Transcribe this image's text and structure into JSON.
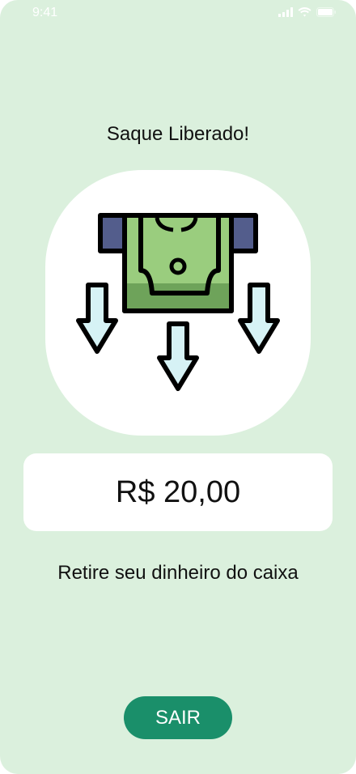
{
  "status_bar": {
    "time": "9:41"
  },
  "title": "Saque Liberado!",
  "illustration": {
    "icon": "cash-withdrawal-icon"
  },
  "amount": "R$ 20,00",
  "instruction": "Retire seu dinheiro do caixa",
  "exit_button": {
    "label": "SAIR"
  },
  "colors": {
    "background": "#dbf0dd",
    "card": "#ffffff",
    "button": "#1a8f6a",
    "button_text": "#ffffff",
    "banknote_light": "#9acd7e",
    "banknote_dark": "#6ea35a",
    "slot": "#535d8c",
    "arrow_fill": "#d6f2f5"
  }
}
